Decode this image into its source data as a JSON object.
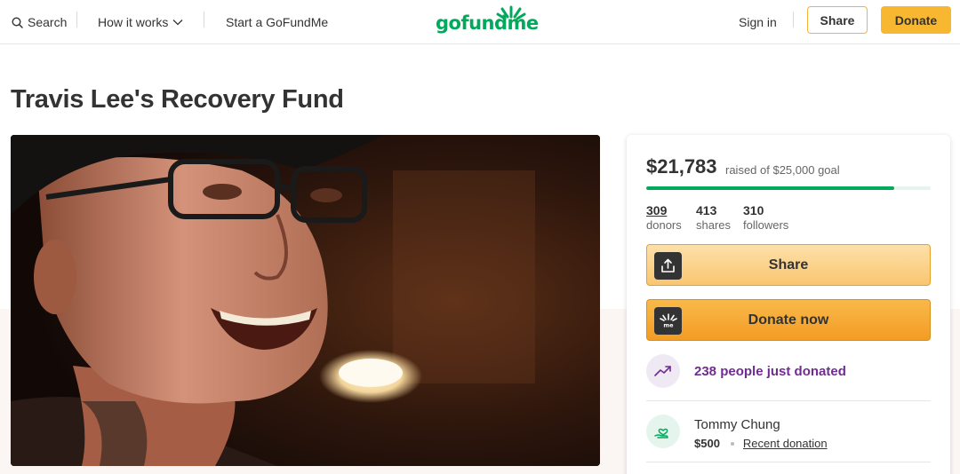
{
  "header": {
    "search_label": "Search",
    "how_it_works_label": "How it works",
    "start_label": "Start a GoFundMe",
    "logo_text": "gofundme",
    "sign_in_label": "Sign in",
    "share_label": "Share",
    "donate_label": "Donate"
  },
  "campaign": {
    "title": "Travis Lee's Recovery Fund",
    "photo": "portrait of smiling man with glasses and cap"
  },
  "card": {
    "amount": "$21,783",
    "goal_text": "raised of $25,000 goal",
    "progress_fraction": 0.871,
    "stats": [
      {
        "value": "309",
        "label": "donors"
      },
      {
        "value": "413",
        "label": "shares"
      },
      {
        "value": "310",
        "label": "followers"
      }
    ],
    "share_label": "Share",
    "donate_label": "Donate now",
    "recent_count_text": "238 people just donated",
    "recent_donor": {
      "name": "Tommy Chung",
      "amount": "$500",
      "tag": "Recent donation"
    }
  },
  "colors": {
    "brand_green": "#02a95c",
    "donate_orange": "#f7b731",
    "trend_purple": "#6f2c91"
  },
  "icons": [
    "search-icon",
    "chevron-down-icon",
    "share-upload-icon",
    "gofundme-logo-icon",
    "trending-up-icon",
    "donor-hand-heart-icon"
  ]
}
